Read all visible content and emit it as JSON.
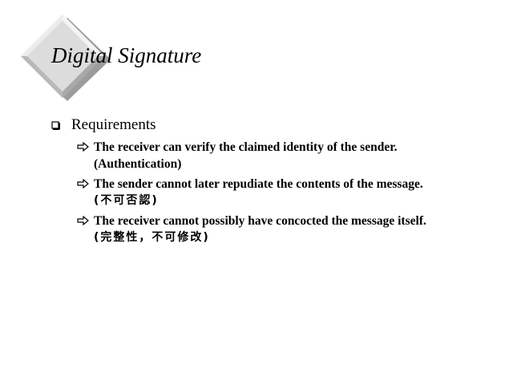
{
  "slide": {
    "title": "Digital Signature",
    "bullet": "Requirements",
    "sub_items": [
      {
        "line1": "The receiver can verify the claimed identity of the sender.",
        "line2": "(Authentication)"
      },
      {
        "line1": "The sender cannot later repudiate the contents of the message.",
        "line2": "(不可否認)"
      },
      {
        "line1": "The receiver cannot possibly have concocted the message itself.",
        "line2": "(完整性，不可修改)"
      }
    ]
  },
  "icons": {
    "title_decoration": "diamond-icon",
    "level1_bullet": "hollow-square-bullet-icon",
    "level2_bullet": "hollow-right-arrow-icon"
  },
  "colors": {
    "background": "#ffffff",
    "text": "#000000",
    "diamond_light": "#d8d8d8",
    "diamond_shadow": "#9c9c9c"
  }
}
